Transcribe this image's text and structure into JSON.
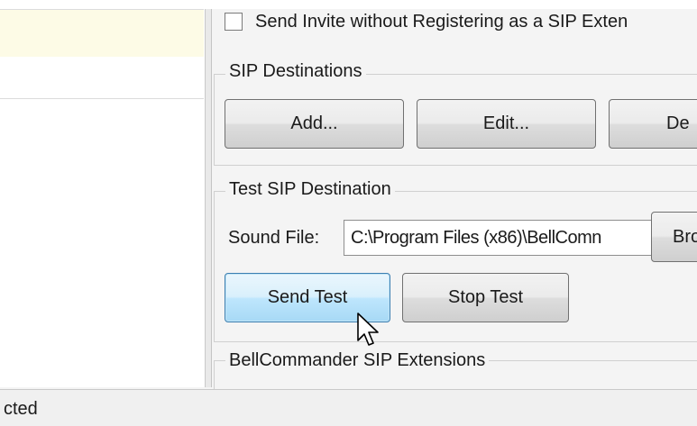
{
  "options": {
    "send_invite_checkbox": {
      "label": "Send Invite without Registering as a SIP Exten",
      "checked": false
    }
  },
  "sip_destinations": {
    "title": "SIP Destinations",
    "add_label": "Add...",
    "edit_label": "Edit...",
    "delete_label": "De"
  },
  "test_sip_destination": {
    "title": "Test SIP Destination",
    "sound_file_label": "Sound File:",
    "sound_file_value": "C:\\Program Files (x86)\\BellComn",
    "browse_label": "Bro",
    "send_test_label": "Send Test",
    "stop_test_label": "Stop Test"
  },
  "extensions": {
    "title": "BellCommander SIP Extensions"
  },
  "status_bar": {
    "text": "cted"
  },
  "icons": {
    "cursor": "mouse-pointer-icon"
  },
  "colors": {
    "selected_row": "#fdfbe6",
    "focused_button": "#bee6fd"
  }
}
